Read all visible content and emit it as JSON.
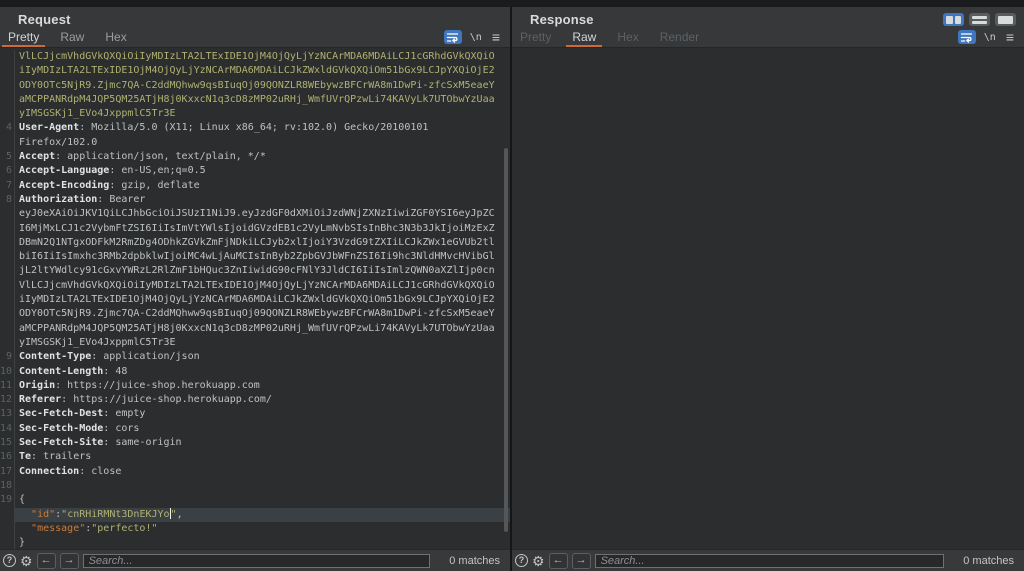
{
  "window": {
    "layout_buttons": [
      {
        "name": "layout-columns-button",
        "kind": "columns",
        "selected": true
      },
      {
        "name": "layout-rows-button",
        "kind": "rows",
        "selected": false
      },
      {
        "name": "layout-single-button",
        "kind": "single",
        "selected": false
      }
    ]
  },
  "icons": {
    "help": "?",
    "gear": "⚙",
    "prev_arrow": "←",
    "next_arrow": "→",
    "newline": "\\n",
    "menu": "≡"
  },
  "request_panel": {
    "title": "Request",
    "tabs": [
      {
        "label": "Pretty",
        "state": "selected"
      },
      {
        "label": "Raw",
        "state": "enabled"
      },
      {
        "label": "Hex",
        "state": "enabled"
      }
    ],
    "search": {
      "placeholder": "Search...",
      "matches": "0 matches"
    },
    "lines": [
      {
        "num": "",
        "segs": [
          [
            "olive",
            "VlLCJjcmVhdGVkQXQiOiIyMDIzLTA2LTExIDE1OjM4OjQyLjYzNCArMDA6MDAiLCJ1cGRhdGVkQXQiO"
          ]
        ]
      },
      {
        "num": "",
        "segs": [
          [
            "olive",
            "iIyMDIzLTA2LTExIDE1OjM4OjQyLjYzNCArMDA6MDAiLCJkZWxldGVkQXQiOm51bGx9LCJpYXQiOjE2"
          ]
        ]
      },
      {
        "num": "",
        "segs": [
          [
            "olive",
            "ODY0OTc5NjR9.Zjmc7QA-C2ddMQhww9qsBIuqOj09QONZLR8WEbywzBFCrWA8m1DwPi-zfcSxM5eaeY"
          ]
        ]
      },
      {
        "num": "",
        "segs": [
          [
            "olive",
            "aMCPPANRdpM4JQP5QM25ATjH8j0KxxcN1q3cD8zMP02uRHj_WmfUVrQPzwLi74KAVyLk7UTObwYzUaa"
          ]
        ]
      },
      {
        "num": "",
        "segs": [
          [
            "olive",
            "yIMSGSKj1_EVo4JxppmlC5Tr3E"
          ]
        ]
      },
      {
        "num": "4",
        "segs": [
          [
            "name",
            "User-Agent"
          ],
          [
            "plain",
            ": Mozilla/5.0 (X11; Linux x86_64; rv:102.0) Gecko/20100101"
          ]
        ]
      },
      {
        "num": "",
        "segs": [
          [
            "plain",
            "Firefox/102.0"
          ]
        ]
      },
      {
        "num": "5",
        "segs": [
          [
            "name",
            "Accept"
          ],
          [
            "plain",
            ": application/json, text/plain, */*"
          ]
        ]
      },
      {
        "num": "6",
        "segs": [
          [
            "name",
            "Accept-Language"
          ],
          [
            "plain",
            ": en-US,en;q=0.5"
          ]
        ]
      },
      {
        "num": "7",
        "segs": [
          [
            "name",
            "Accept-Encoding"
          ],
          [
            "plain",
            ": gzip, deflate"
          ]
        ]
      },
      {
        "num": "8",
        "segs": [
          [
            "name",
            "Authorization"
          ],
          [
            "plain",
            ": Bearer"
          ]
        ]
      },
      {
        "num": "",
        "segs": [
          [
            "plain",
            "eyJ0eXAiOiJKV1QiLCJhbGciOiJSUzI1NiJ9.eyJzdGF0dXMiOiJzdWNjZXNzIiwiZGF0YSI6eyJpZC"
          ]
        ]
      },
      {
        "num": "",
        "segs": [
          [
            "plain",
            "I6MjMxLCJ1c2VybmFtZSI6IiIsImVtYWlsIjoidGVzdEB1c2VyLmNvbSIsInBhc3N3b3JkIjoiMzExZ"
          ]
        ]
      },
      {
        "num": "",
        "segs": [
          [
            "plain",
            "DBmN2Q1NTgxODFkM2RmZDg4ODhkZGVkZmFjNDkiLCJyb2xlIjoiY3VzdG9tZXIiLCJkZWx1eGVUb2tl"
          ]
        ]
      },
      {
        "num": "",
        "segs": [
          [
            "plain",
            "biI6IiIsImxhc3RMb2dpbklwIjoiMC4wLjAuMCIsInByb2ZpbGVJbWFnZSI6Ii9hc3NldHMvcHVibGl"
          ]
        ]
      },
      {
        "num": "",
        "segs": [
          [
            "plain",
            "jL2ltYWdlcy91cGxvYWRzL2RlZmF1bHQuc3ZnIiwidG90cFNlY3JldCI6IiIsImlzQWN0aXZlIjp0cn"
          ]
        ]
      },
      {
        "num": "",
        "segs": [
          [
            "plain",
            "VlLCJjcmVhdGVkQXQiOiIyMDIzLTA2LTExIDE1OjM4OjQyLjYzNCArMDA6MDAiLCJ1cGRhdGVkQXQiO"
          ]
        ]
      },
      {
        "num": "",
        "segs": [
          [
            "plain",
            "iIyMDIzLTA2LTExIDE1OjM4OjQyLjYzNCArMDA6MDAiLCJkZWxldGVkQXQiOm51bGx9LCJpYXQiOjE2"
          ]
        ]
      },
      {
        "num": "",
        "segs": [
          [
            "plain",
            "ODY0OTc5NjR9.Zjmc7QA-C2ddMQhww9qsBIuqOj09QONZLR8WEbywzBFCrWA8m1DwPi-zfcSxM5eaeY"
          ]
        ]
      },
      {
        "num": "",
        "segs": [
          [
            "plain",
            "aMCPPANRdpM4JQP5QM25ATjH8j0KxxcN1q3cD8zMP02uRHj_WmfUVrQPzwLi74KAVyLk7UTObwYzUaa"
          ]
        ]
      },
      {
        "num": "",
        "segs": [
          [
            "plain",
            "yIMSGSKj1_EVo4JxppmlC5Tr3E"
          ]
        ]
      },
      {
        "num": "9",
        "segs": [
          [
            "name",
            "Content-Type"
          ],
          [
            "plain",
            ": application/json"
          ]
        ]
      },
      {
        "num": "10",
        "segs": [
          [
            "name",
            "Content-Length"
          ],
          [
            "plain",
            ": 48"
          ]
        ]
      },
      {
        "num": "11",
        "segs": [
          [
            "name",
            "Origin"
          ],
          [
            "plain",
            ": https://juice-shop.herokuapp.com"
          ]
        ]
      },
      {
        "num": "12",
        "segs": [
          [
            "name",
            "Referer"
          ],
          [
            "plain",
            ": https://juice-shop.herokuapp.com/"
          ]
        ]
      },
      {
        "num": "13",
        "segs": [
          [
            "name",
            "Sec-Fetch-Dest"
          ],
          [
            "plain",
            ": empty"
          ]
        ]
      },
      {
        "num": "14",
        "segs": [
          [
            "name",
            "Sec-Fetch-Mode"
          ],
          [
            "plain",
            ": cors"
          ]
        ]
      },
      {
        "num": "15",
        "segs": [
          [
            "name",
            "Sec-Fetch-Site"
          ],
          [
            "plain",
            ": same-origin"
          ]
        ]
      },
      {
        "num": "16",
        "segs": [
          [
            "name",
            "Te"
          ],
          [
            "plain",
            ": trailers"
          ]
        ]
      },
      {
        "num": "17",
        "segs": [
          [
            "name",
            "Connection"
          ],
          [
            "plain",
            ": close"
          ]
        ]
      },
      {
        "num": "18",
        "segs": []
      },
      {
        "num": "19",
        "segs": [
          [
            "plain",
            "{"
          ]
        ]
      },
      {
        "num": "",
        "hl": true,
        "segs": [
          [
            "plain",
            "  "
          ],
          [
            "key",
            "\"id\""
          ],
          [
            "plain",
            ":"
          ],
          [
            "olive",
            "\"cnRHiRMNt3DnEKJYo"
          ],
          [
            "cursor",
            ""
          ],
          [
            "olive",
            "\""
          ],
          [
            "plain",
            ","
          ]
        ]
      },
      {
        "num": "",
        "segs": [
          [
            "plain",
            "  "
          ],
          [
            "key",
            "\"message\""
          ],
          [
            "plain",
            ":"
          ],
          [
            "olive",
            "\"perfecto!\""
          ]
        ]
      },
      {
        "num": "",
        "segs": [
          [
            "plain",
            "}"
          ]
        ]
      }
    ]
  },
  "response_panel": {
    "title": "Response",
    "tabs": [
      {
        "label": "Pretty",
        "state": "disabled"
      },
      {
        "label": "Raw",
        "state": "selected"
      },
      {
        "label": "Hex",
        "state": "disabled"
      },
      {
        "label": "Render",
        "state": "disabled"
      }
    ],
    "search": {
      "placeholder": "Search...",
      "matches": "0 matches"
    },
    "lines": []
  }
}
